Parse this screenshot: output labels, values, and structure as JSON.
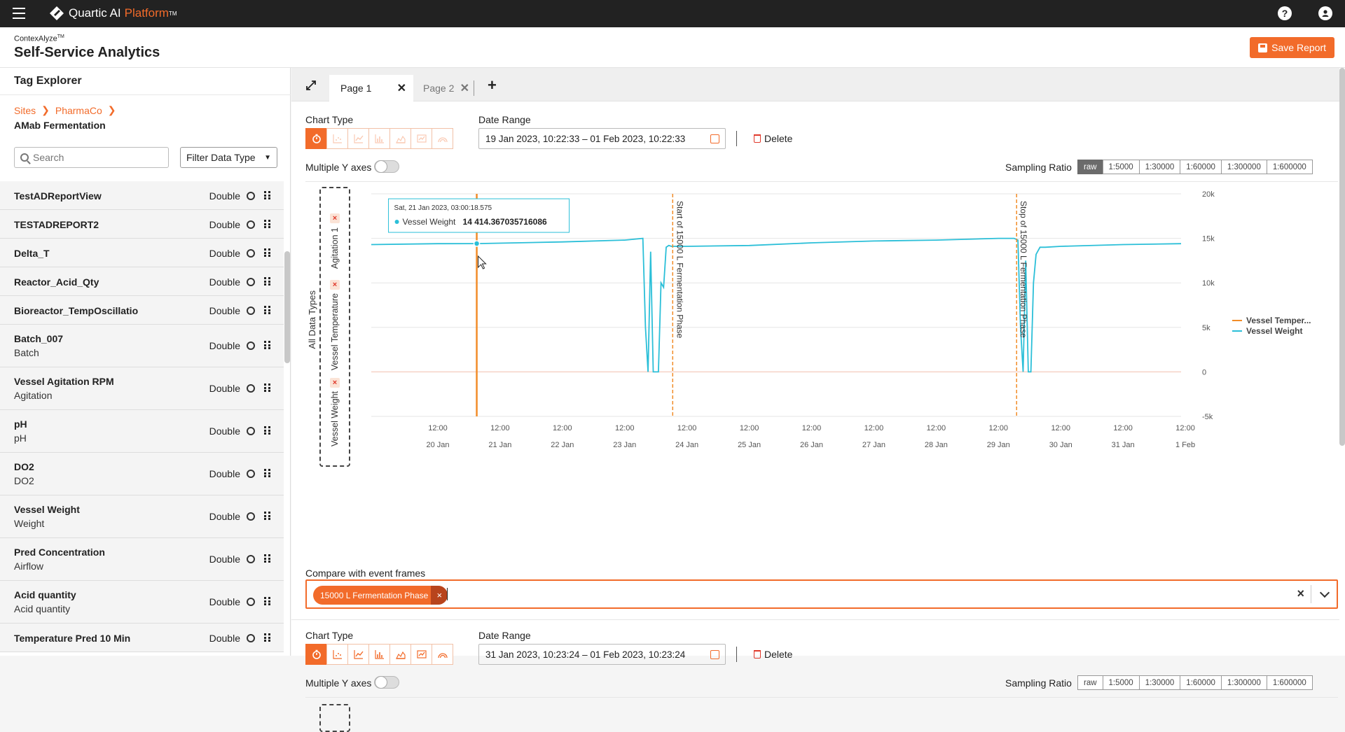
{
  "topbar": {
    "brand_a": "Quartic AI",
    "brand_b": "Platform",
    "brand_tm": "TM",
    "help_glyph": "?",
    "icons": [
      "menu-icon",
      "help-icon",
      "account-icon"
    ]
  },
  "header": {
    "subtitle": "ContexAlyze",
    "subtitle_tm": "TM",
    "title": "Self-Service Analytics",
    "save_label": "Save Report"
  },
  "sidebar": {
    "title": "Tag Explorer",
    "breadcrumbs": [
      "Sites",
      "PharmaCo"
    ],
    "current": "AMab Fermentation",
    "search_placeholder": "Search",
    "filter_label": "Filter Data Type",
    "items": [
      {
        "name": "TestADReportView",
        "sub": "",
        "type": "Double"
      },
      {
        "name": "TESTADREPORT2",
        "sub": "",
        "type": "Double"
      },
      {
        "name": "Delta_T",
        "sub": "",
        "type": "Double"
      },
      {
        "name": "Reactor_Acid_Qty",
        "sub": "",
        "type": "Double"
      },
      {
        "name": "Bioreactor_TempOscillatio",
        "sub": "",
        "type": "Double"
      },
      {
        "name": "Batch_007",
        "sub": "Batch",
        "type": "Double"
      },
      {
        "name": "Vessel Agitation RPM",
        "sub": "Agitation",
        "type": "Double"
      },
      {
        "name": "pH",
        "sub": "pH",
        "type": "Double"
      },
      {
        "name": "DO2",
        "sub": "DO2",
        "type": "Double"
      },
      {
        "name": "Vessel Weight",
        "sub": "Weight",
        "type": "Double"
      },
      {
        "name": "Pred Concentration",
        "sub": "Airflow",
        "type": "Double"
      },
      {
        "name": "Acid quantity",
        "sub": "Acid quantity",
        "type": "Double"
      },
      {
        "name": "Temperature Pred 10 Min",
        "sub": "",
        "type": "Double"
      }
    ]
  },
  "tabs": [
    {
      "label": "Page 1",
      "active": true
    },
    {
      "label": "Page 2",
      "active": false
    }
  ],
  "panel1": {
    "chart_type_label": "Chart Type",
    "date_range_label": "Date Range",
    "date_range": "19 Jan 2023, 10:22:33 – 01 Feb 2023, 10:22:33",
    "delete_label": "Delete",
    "multiple_y_label": "Multiple Y axes",
    "sampling_label": "Sampling Ratio",
    "sampling_options": [
      "raw",
      "1:5000",
      "1:30000",
      "1:60000",
      "1:300000",
      "1:600000"
    ],
    "sampling_selected": "raw",
    "all_types_label": "All Data Types",
    "drop_tags": [
      "Agitation 1",
      "Vessel Temperature",
      "Vessel Weight"
    ]
  },
  "compare": {
    "label": "Compare with event frames",
    "chip": "15000 L Fermentation Phase",
    "chip_x": "×",
    "clear_x": "×"
  },
  "panel2": {
    "chart_type_label": "Chart Type",
    "date_range_label": "Date Range",
    "date_range": "31 Jan 2023, 10:23:24 – 01 Feb 2023, 10:23:24",
    "delete_label": "Delete",
    "multiple_y_label": "Multiple Y axes",
    "sampling_label": "Sampling Ratio",
    "sampling_options": [
      "raw",
      "1:5000",
      "1:30000",
      "1:60000",
      "1:300000",
      "1:600000"
    ],
    "sampling_selected": ""
  },
  "chart_data": {
    "type": "line",
    "title": "",
    "ylabel": "",
    "ylim": [
      -5000,
      20000
    ],
    "yticks": [
      -5000,
      0,
      5000,
      10000,
      15000,
      20000
    ],
    "ytick_labels": [
      "-5k",
      "0",
      "5k",
      "10k",
      "15k",
      "20k"
    ],
    "xlim": [
      "2023-01-19T10:22",
      "2023-02-01T10:22"
    ],
    "xticks_time": [
      "12:00",
      "12:00",
      "12:00",
      "12:00",
      "12:00",
      "12:00",
      "12:00",
      "12:00",
      "12:00",
      "12:00",
      "12:00",
      "12:00",
      "12:00"
    ],
    "xticks_date": [
      "20 Jan",
      "21 Jan",
      "22 Jan",
      "23 Jan",
      "24 Jan",
      "25 Jan",
      "26 Jan",
      "27 Jan",
      "28 Jan",
      "29 Jan",
      "30 Jan",
      "31 Jan",
      "1 Feb"
    ],
    "legend": [
      {
        "name": "Vessel Temper...",
        "color": "#f28c28"
      },
      {
        "name": "Vessel Weight",
        "color": "#2bbfd8"
      }
    ],
    "series": [
      {
        "name": "Vessel Weight",
        "color": "#2bbfd8",
        "x": [
          "2023-01-19T10:22",
          "2023-01-20T12:00",
          "2023-01-21T03:00",
          "2023-01-22T12:00",
          "2023-01-23T12:00",
          "2023-01-23T19:00",
          "2023-01-23T20:00",
          "2023-01-23T21:00",
          "2023-01-23T22:00",
          "2023-01-23T23:00",
          "2023-01-24T00:00",
          "2023-01-24T01:00",
          "2023-01-24T02:00",
          "2023-01-24T03:00",
          "2023-01-24T04:00",
          "2023-01-24T05:00",
          "2023-01-24T06:00",
          "2023-01-24T09:00",
          "2023-01-24T12:00",
          "2023-01-25T12:00",
          "2023-01-26T12:00",
          "2023-01-27T12:00",
          "2023-01-28T12:00",
          "2023-01-29T12:00",
          "2023-01-29T18:00",
          "2023-01-29T19:30",
          "2023-01-29T20:30",
          "2023-01-29T21:30",
          "2023-01-29T22:30",
          "2023-01-29T23:30",
          "2023-01-30T00:30",
          "2023-01-30T01:30",
          "2023-01-30T02:30",
          "2023-01-30T04:00",
          "2023-01-30T06:00",
          "2023-01-30T12:00",
          "2023-01-31T12:00",
          "2023-02-01T10:22"
        ],
        "values": [
          14300,
          14400,
          14414,
          14600,
          14800,
          15000,
          5000,
          0,
          13500,
          0,
          0,
          0,
          10000,
          9500,
          14000,
          14200,
          14100,
          14100,
          14100,
          14200,
          14500,
          14700,
          14800,
          15000,
          15000,
          14800,
          5000,
          0,
          12500,
          0,
          0,
          10000,
          13200,
          14000,
          14000,
          14100,
          14300,
          14400
        ]
      }
    ],
    "cursor": {
      "x": "2023-01-21T03:00:18.575",
      "y": 14414.367035716086,
      "color": "#f28c28"
    },
    "tooltip": {
      "time": "Sat, 21 Jan 2023, 03:00:18.575",
      "series": "Vessel Weight",
      "value_text": "14 414.367035716086"
    },
    "event_frames": [
      {
        "x": "2023-01-24T06:30",
        "label": "Start of 15000 L Fermentation Phase"
      },
      {
        "x": "2023-01-29T19:00",
        "label": "Stop of 15000 L Fermentation Phase"
      }
    ]
  }
}
